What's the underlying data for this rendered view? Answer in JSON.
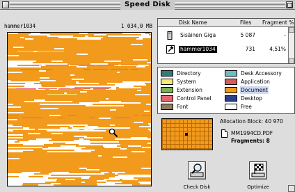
{
  "window": {
    "title": "Speed Disk"
  },
  "volume_pane": {
    "volume_name": "hammer1034",
    "volume_size": "1 034,0 MB",
    "legend_colors": {
      "document": "#f29a1c",
      "control_panel": "#e06570",
      "system": "#f5e87a",
      "free": "#ffffff"
    }
  },
  "file_list": {
    "columns": [
      "Disk Name",
      "Files",
      "Fragment %"
    ],
    "rows": [
      {
        "icon": "disk-icon",
        "name": "Sisäinen Giga",
        "files": "5 087",
        "fragment": "-",
        "selected": false
      },
      {
        "icon": "hammer-disk-icon",
        "name": "hammer1034",
        "files": "731",
        "fragment": "4,51%",
        "selected": true
      }
    ]
  },
  "legend": {
    "items": [
      {
        "label": "Directory",
        "color": "#2f7d77"
      },
      {
        "label": "Desk Accessory",
        "color": "#6dbcc2"
      },
      {
        "label": "System",
        "color": "#f5e87a"
      },
      {
        "label": "Application",
        "color": "#d95a5a"
      },
      {
        "label": "Extension",
        "color": "#7ab356"
      },
      {
        "label": "Document",
        "color": "#f29a1c"
      },
      {
        "label": "Control Panel",
        "color": "#e06570"
      },
      {
        "label": "Desktop",
        "color": "#2b3f86"
      },
      {
        "label": "Font",
        "color": "#8f7a5a"
      },
      {
        "label": "Free",
        "color": "#ffffff"
      }
    ],
    "highlighted": "Document"
  },
  "allocation": {
    "title": "Allocation Block: 40 970",
    "file_name": "MM1994CD.PDF",
    "fragments": "Fragments: 8"
  },
  "buttons": {
    "check_disk": "Check Disk",
    "optimize": "Optimize"
  },
  "icons": {
    "close_box": "close-box-icon",
    "zoom_box": "zoom-box-icon",
    "magnifier": "magnifier-icon",
    "check_disk": "magnifier-disk-icon",
    "optimize": "checkered-flag-icon"
  }
}
